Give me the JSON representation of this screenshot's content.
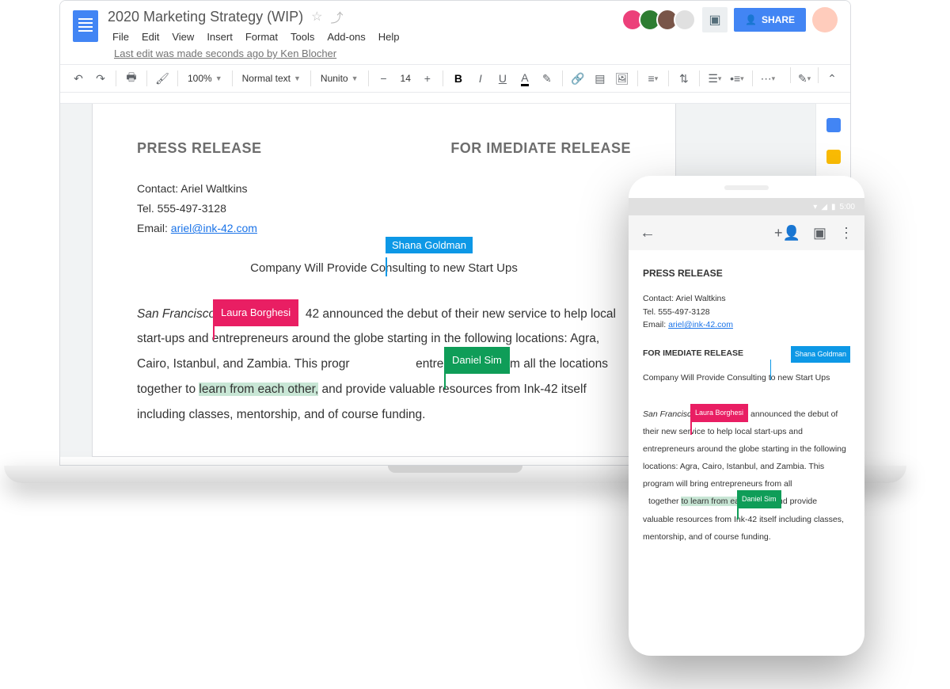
{
  "header": {
    "doc_title": "2020 Marketing Strategy (WIP)",
    "menus": [
      "File",
      "Edit",
      "View",
      "Insert",
      "Format",
      "Tools",
      "Add-ons",
      "Help"
    ],
    "edit_status": "Last edit was made seconds ago by Ken Blocher",
    "share_label": "SHARE"
  },
  "toolbar": {
    "zoom": "100%",
    "style": "Normal text",
    "font": "Nunito",
    "size": "14"
  },
  "doc": {
    "press_release": "PRESS RELEASE",
    "for_release": "FOR IMEDIATE RELEASE",
    "contact_label": "Contact: Ariel Waltkins",
    "tel": "Tel. 555-497-3128",
    "email_label": "Email: ",
    "email": "ariel@ink-42.com",
    "headline_a": "Company Will Provide Consulting",
    "headline_b": " to new Start Ups",
    "loc": "San Francisco",
    "body_a": " 42 announced the debut of their new service to help local start-ups and entrepreneurs around the globe starting in the following locations: Agra, Cairo, Istanbul, and Zambia. This progr",
    "body_b": " entrepreneurs from all the locations together to ",
    "body_hl": "learn from each other,",
    "body_c": " and provide valuable resources from Ink-42 itself including classes, mentorship, and of course funding."
  },
  "collaborators": {
    "shana": "Shana Goldman",
    "laura": "Laura Borghesi",
    "daniel": "Daniel Sim"
  },
  "phone": {
    "time": "5:00",
    "press_release": "PRESS RELEASE",
    "contact": "Contact: Ariel Waltkins",
    "tel": "Tel. 555-497-3128",
    "email_label": "Email: ",
    "email": "ariel@ink-42.com",
    "for_release": "FOR IMEDIATE RELEASE",
    "headline": "Company Will Provide Consulting  to new Start Ups",
    "loc": "San Francisc",
    "body_a": "k 42 announced the debut of their new service to help local start-ups and entrepreneurs around the globe starting in the following locations: Agra, Cairo, Istanbul, and Zambia. This program will bring entrepreneurs from all ",
    "body_b": "together ",
    "body_hl": "to learn from each other,",
    "body_c": " and provide valuable resources from Ink-42 itself including classes, mentorship, and of course funding."
  }
}
